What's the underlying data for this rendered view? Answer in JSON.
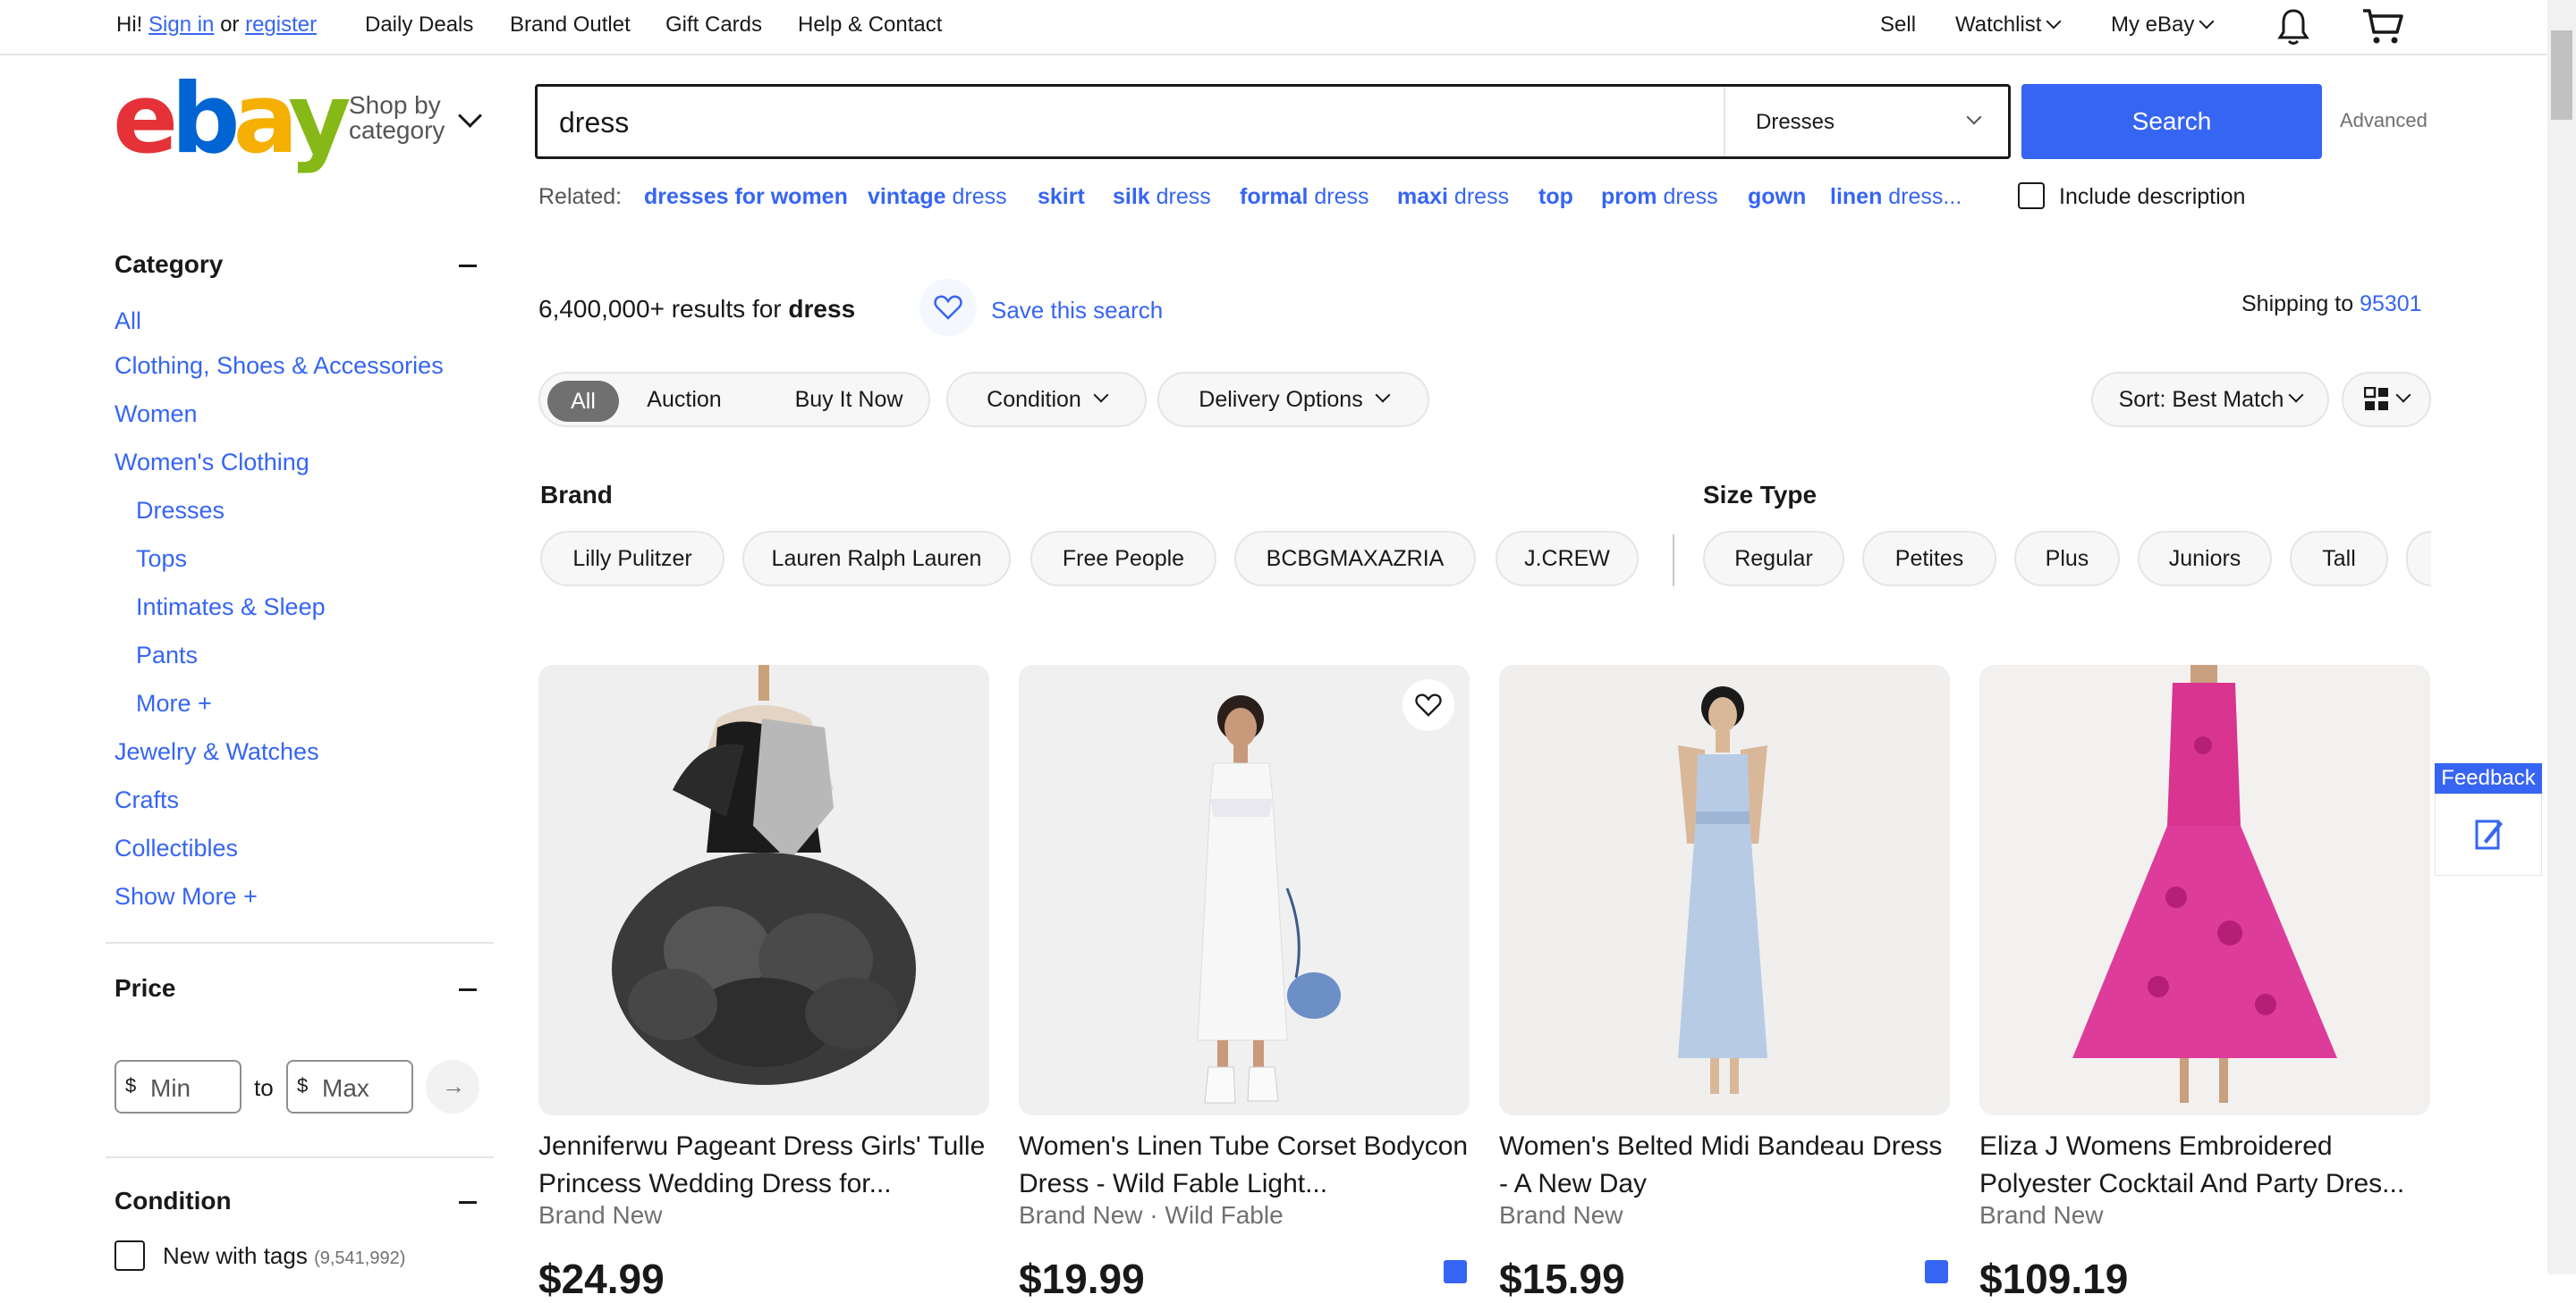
{
  "topbar": {
    "greeting": "Hi!",
    "signin": "Sign in",
    "or": "or",
    "register": "register",
    "links": [
      "Daily Deals",
      "Brand Outlet",
      "Gift Cards",
      "Help & Contact"
    ],
    "sell": "Sell",
    "watchlist": "Watchlist",
    "myebay": "My eBay"
  },
  "header": {
    "logo": {
      "e": "e",
      "b": "b",
      "a": "a",
      "y": "y"
    },
    "shop_by_line1": "Shop by",
    "shop_by_line2": "category",
    "search_value": "dress",
    "category_select": "Dresses",
    "search_button": "Search",
    "advanced": "Advanced"
  },
  "related": {
    "label": "Related:",
    "items": [
      {
        "bold": "dresses for women",
        "rest": ""
      },
      {
        "bold": "vintage",
        "rest": " dress"
      },
      {
        "bold": "skirt",
        "rest": ""
      },
      {
        "bold": "silk",
        "rest": " dress"
      },
      {
        "bold": "formal",
        "rest": " dress"
      },
      {
        "bold": "maxi",
        "rest": " dress"
      },
      {
        "bold": "top",
        "rest": ""
      },
      {
        "bold": "prom",
        "rest": " dress"
      },
      {
        "bold": "gown",
        "rest": ""
      },
      {
        "bold": "linen",
        "rest": " dress..."
      }
    ],
    "include_description": "Include description"
  },
  "sidebar": {
    "category_heading": "Category",
    "categories": [
      "All",
      "Clothing, Shoes & Accessories",
      "Women",
      "Women's Clothing"
    ],
    "subcategories": [
      "Dresses",
      "Tops",
      "Intimates & Sleep",
      "Pants",
      "More"
    ],
    "more_categories": [
      "Jewelry & Watches",
      "Crafts",
      "Collectibles",
      "Show More"
    ],
    "price_heading": "Price",
    "currency": "$",
    "min_placeholder": "Min",
    "to": "to",
    "max_placeholder": "Max",
    "condition_heading": "Condition",
    "condition_option": "New with tags",
    "condition_count": "(9,541,992)"
  },
  "results": {
    "count": "6,400,000+",
    "results_for": "results for",
    "query": "dress",
    "save_search": "Save this search",
    "shipping_to": "Shipping to",
    "zip": "95301",
    "buying_formats": [
      "All",
      "Auction",
      "Buy It Now"
    ],
    "condition_filter": "Condition",
    "delivery_filter": "Delivery Options",
    "sort": "Sort: Best Match"
  },
  "brand": {
    "heading": "Brand",
    "chips": [
      "Lilly Pulitzer",
      "Lauren Ralph Lauren",
      "Free People",
      "BCBGMAXAZRIA",
      "J.CREW"
    ]
  },
  "size_type": {
    "heading": "Size Type",
    "chips": [
      "Regular",
      "Petites",
      "Plus",
      "Juniors",
      "Tall"
    ]
  },
  "products": [
    {
      "title": "Jenniferwu Pageant Dress Girls' Tulle Princess Wedding Dress for...",
      "sub": "Brand New",
      "price": "$24.99"
    },
    {
      "title": "Women's Linen Tube Corset Bodycon Dress - Wild Fable Light...",
      "sub": "Brand New · Wild Fable",
      "price": "$19.99"
    },
    {
      "title": "Women's Belted Midi Bandeau Dress - A New Day",
      "sub": "Brand New",
      "price": "$15.99"
    },
    {
      "title": "Eliza J Womens Embroidered Polyester Cocktail And Party Dres...",
      "sub": "Brand New",
      "price": "$109.19"
    }
  ],
  "feedback": "Feedback",
  "colors": {
    "accent": "#3665f3",
    "ebay_red": "#e53238",
    "ebay_blue": "#0064d2",
    "ebay_yellow": "#f5af02",
    "ebay_green": "#86b817"
  }
}
